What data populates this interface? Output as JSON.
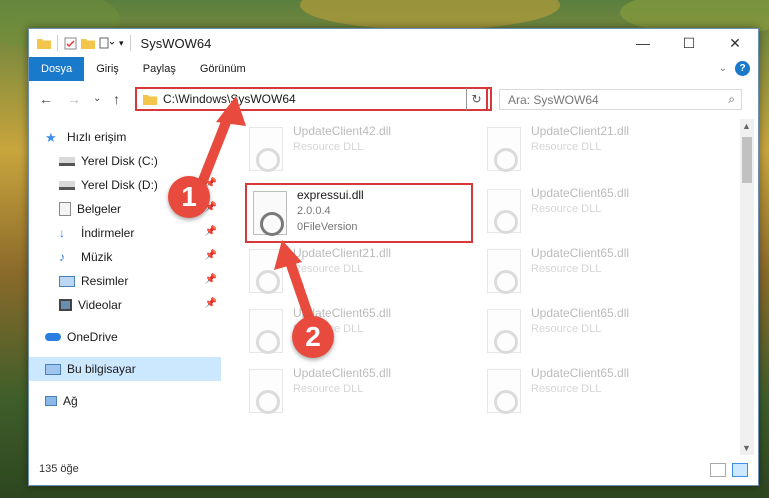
{
  "window": {
    "title": "SysWOW64",
    "controls": {
      "minimize": "—",
      "maximize": "☐",
      "close": "✕"
    }
  },
  "ribbon": {
    "tabs": [
      "Dosya",
      "Giriş",
      "Paylaş",
      "Görünüm"
    ],
    "active_tab": "Dosya",
    "help_label": "?"
  },
  "navigation": {
    "back": "←",
    "forward": "→",
    "recent": "⌄",
    "up": "↑",
    "address": "C:\\Windows\\SysWOW64",
    "search_placeholder": "Ara: SysWOW64"
  },
  "sidebar": {
    "items": [
      {
        "label": "Hızlı erişim",
        "icon": "star-icon",
        "pinned": false
      },
      {
        "label": "Yerel Disk (C:)",
        "icon": "drive-icon",
        "pinned": true
      },
      {
        "label": "Yerel Disk (D:)",
        "icon": "drive-icon",
        "pinned": true
      },
      {
        "label": "Belgeler",
        "icon": "documents-icon",
        "pinned": true
      },
      {
        "label": "İndirmeler",
        "icon": "download-icon",
        "pinned": true
      },
      {
        "label": "Müzik",
        "icon": "music-icon",
        "pinned": true
      },
      {
        "label": "Resimler",
        "icon": "pictures-icon",
        "pinned": true
      },
      {
        "label": "Videolar",
        "icon": "video-icon",
        "pinned": true
      },
      {
        "label": "OneDrive",
        "icon": "cloud-icon",
        "pinned": false
      },
      {
        "label": "Bu bilgisayar",
        "icon": "computer-icon",
        "pinned": false
      },
      {
        "label": "Ağ",
        "icon": "network-icon",
        "pinned": false
      }
    ],
    "selected": "Bu bilgisayar"
  },
  "files": [
    {
      "name": "UpdateClient42.dll",
      "line2": "Resource DLL",
      "line3": ""
    },
    {
      "name": "UpdateClient21.dll",
      "line2": "Resource DLL",
      "line3": ""
    },
    {
      "name": "expressui.dll",
      "line2": "2.0.0.4",
      "line3": "0FileVersion"
    },
    {
      "name": "UpdateClient65.dll",
      "line2": "Resource DLL",
      "line3": ""
    },
    {
      "name": "UpdateClient21.dll",
      "line2": "Resource DLL",
      "line3": ""
    },
    {
      "name": "UpdateClient65.dll",
      "line2": "Resource DLL",
      "line3": ""
    },
    {
      "name": "UpdateClient65.dll",
      "line2": "Resource DLL",
      "line3": ""
    },
    {
      "name": "UpdateClient65.dll",
      "line2": "Resource DLL",
      "line3": ""
    },
    {
      "name": "UpdateClient65.dll",
      "line2": "Resource DLL",
      "line3": ""
    },
    {
      "name": "UpdateClient65.dll",
      "line2": "Resource DLL",
      "line3": ""
    }
  ],
  "status": {
    "item_count": "135 öğe"
  },
  "annotations": {
    "step1": "1",
    "step2": "2"
  },
  "colors": {
    "accent": "#1979ca",
    "highlight": "#d8383a",
    "callout": "#e84b3d"
  }
}
